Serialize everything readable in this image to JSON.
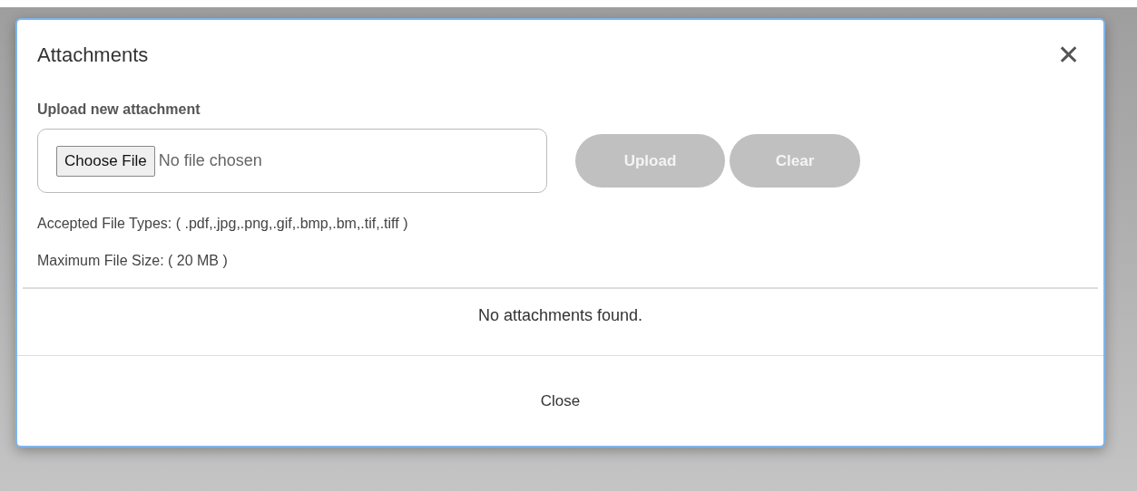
{
  "dialog": {
    "title": "Attachments",
    "close_icon": "✕",
    "upload": {
      "label": "Upload new attachment",
      "choose_button": "Choose File",
      "file_status": "No file chosen",
      "buttons": [
        {
          "label": "Upload",
          "disabled": true
        },
        {
          "label": "Clear",
          "disabled": true
        }
      ],
      "accepted_types": "Accepted File Types: ( .pdf,.jpg,.png,.gif,.bmp,.bm,.tif,.tiff )",
      "max_size": "Maximum File Size: ( 20 MB )"
    },
    "empty_message": "No attachments found.",
    "footer_button": "Close"
  }
}
